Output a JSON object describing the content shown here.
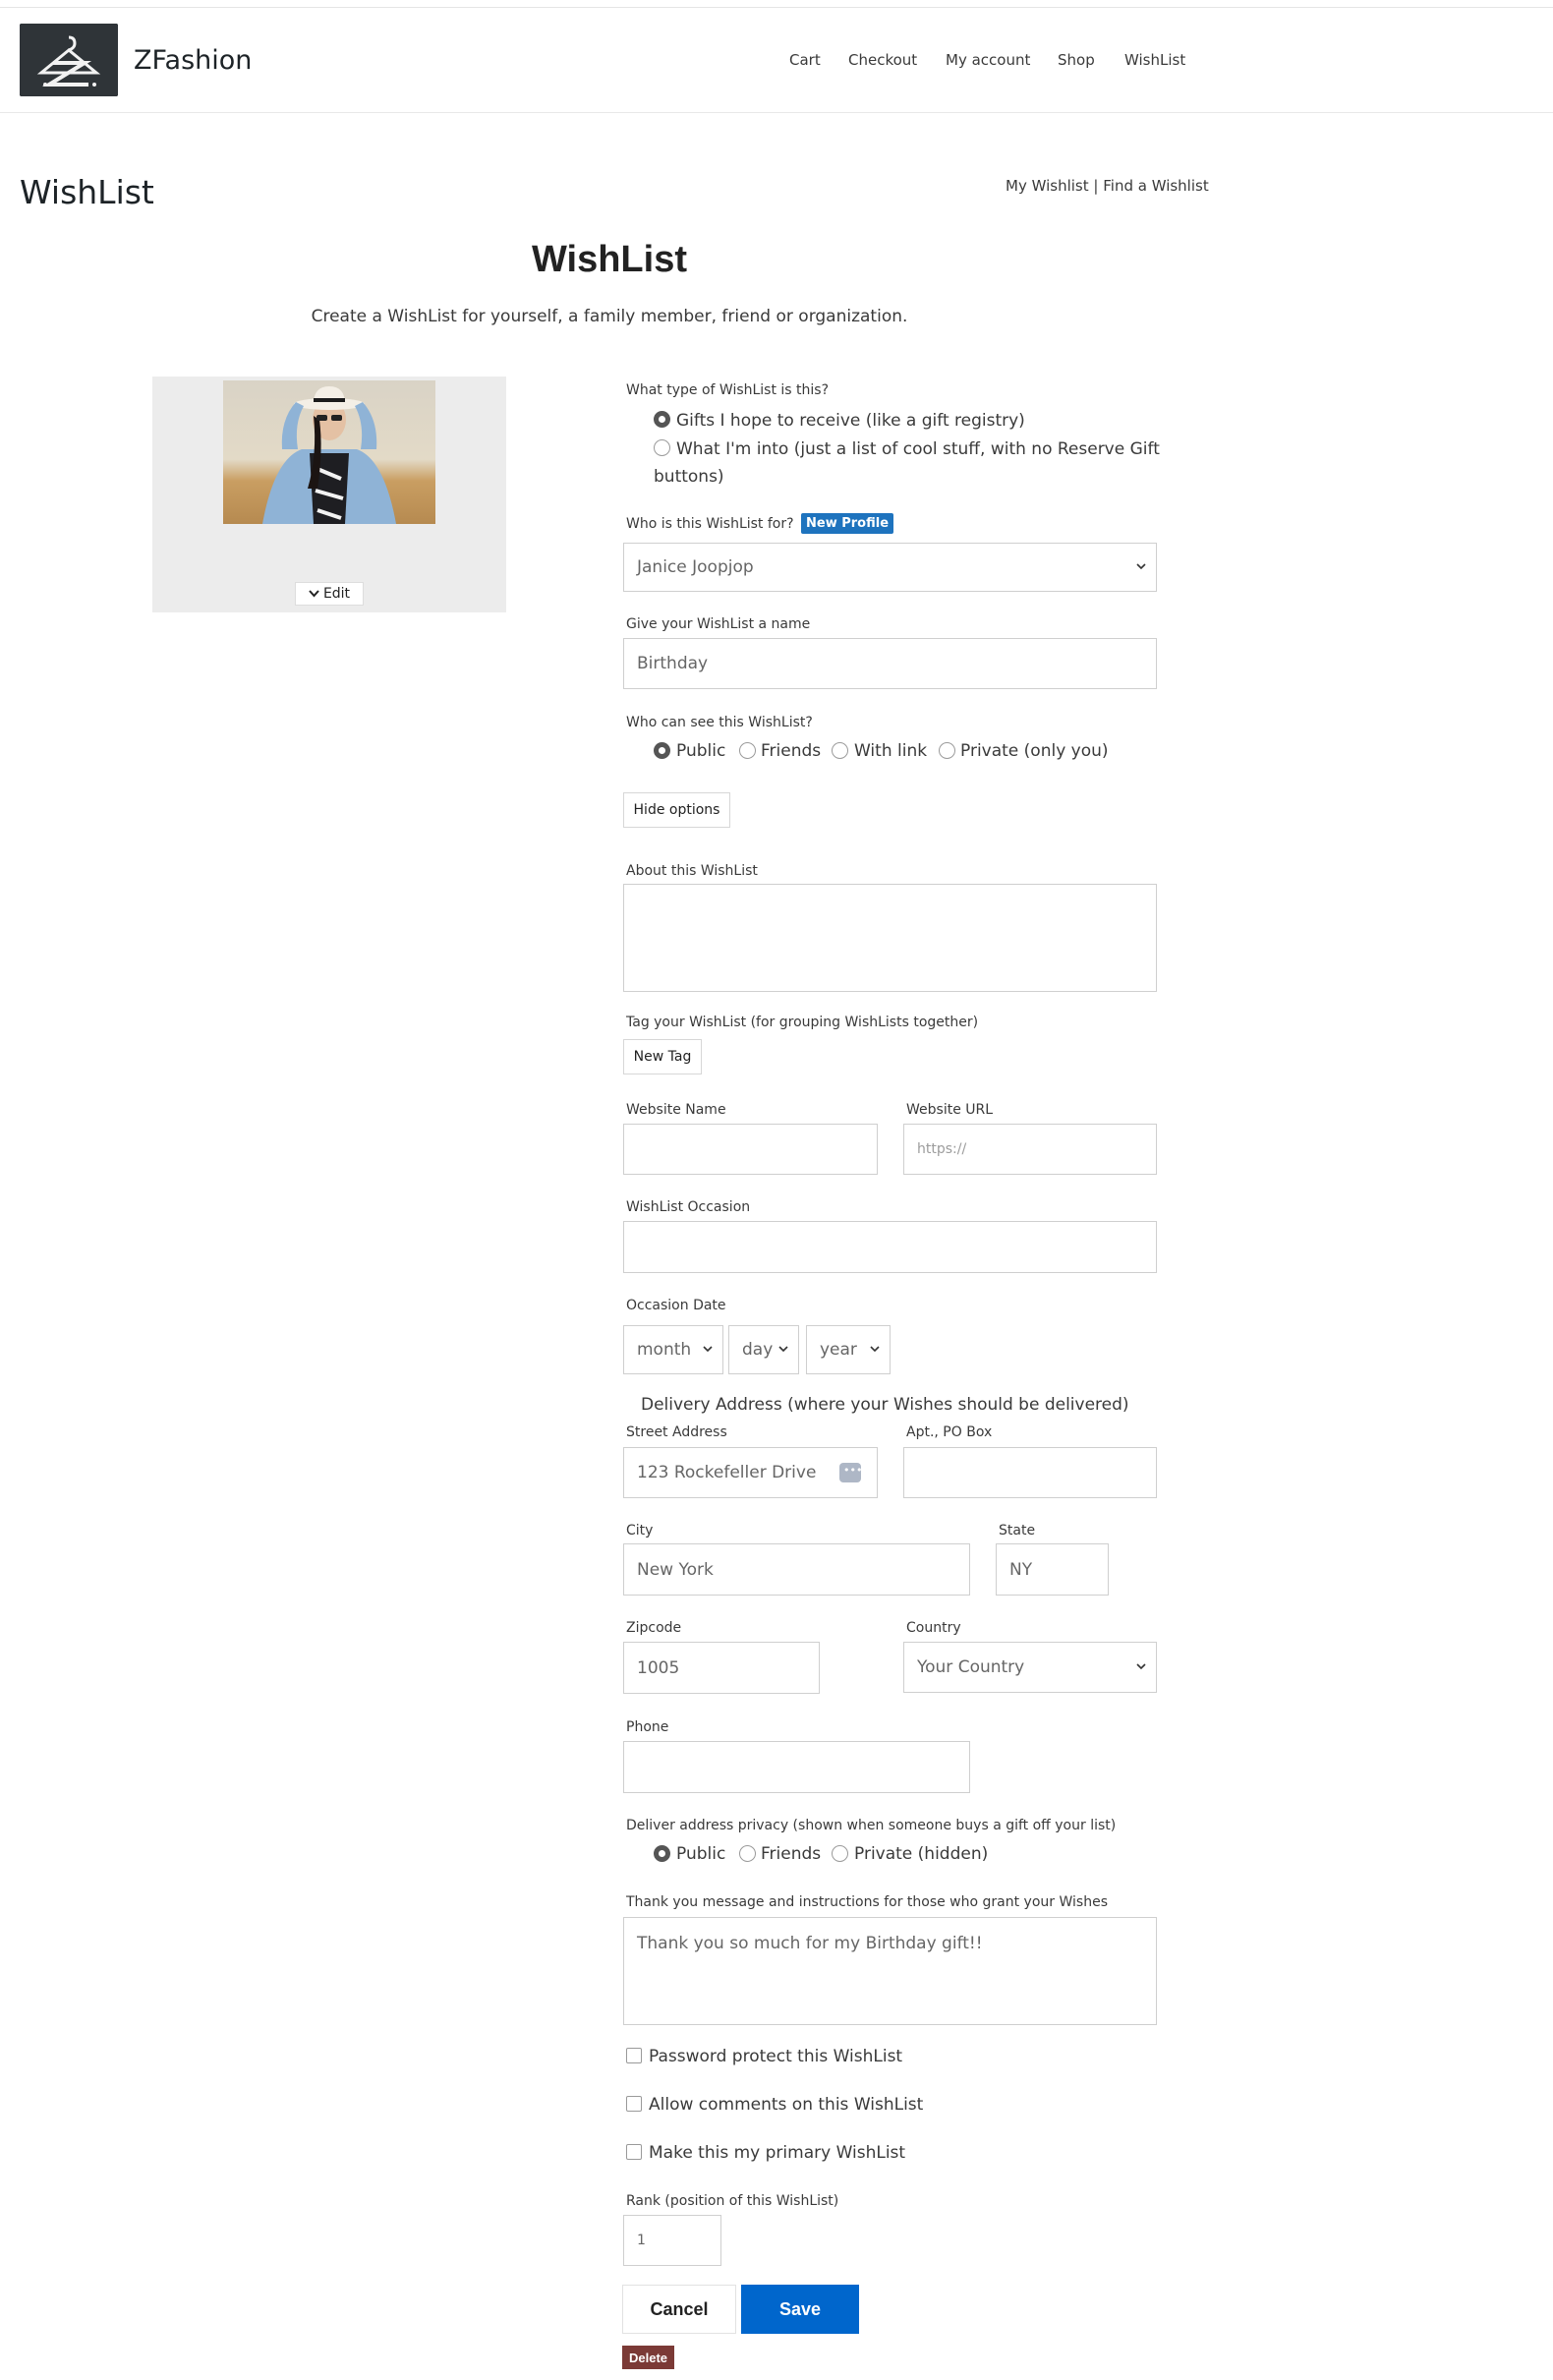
{
  "header": {
    "site_title": "ZFashion",
    "nav": [
      "Cart",
      "Checkout",
      "My account",
      "Shop",
      "WishList"
    ]
  },
  "page": {
    "title": "WishList",
    "links": {
      "my": "My Wishlist",
      "sep": "|",
      "find": "Find a Wishlist"
    }
  },
  "form": {
    "heading": "WishList",
    "subheading": "Create a WishList for yourself, a family member, friend or organization.",
    "image_edit_label": "Edit",
    "type_label": "What type of WishList is this?",
    "type_options": [
      {
        "label": "Gifts I hope to receive (like a gift registry)",
        "selected": true
      },
      {
        "label": "What I'm into (just a list of cool stuff, with no Reserve Gift",
        "label_cont": "buttons)",
        "selected": false
      }
    ],
    "for_label": "Who is this WishList for?",
    "new_profile": "New Profile",
    "for_value": "Janice Joopjop",
    "name_label": "Give your WishList a name",
    "name_value": "Birthday",
    "visibility_label": "Who can see this WishList?",
    "visibility_options": [
      "Public",
      "Friends",
      "With link",
      "Private (only you)"
    ],
    "visibility_selected": "Public",
    "hide_options": "Hide options",
    "about_label": "About this WishList",
    "tag_label": "Tag your WishList (for grouping WishLists together)",
    "new_tag": "New Tag",
    "website_name_label": "Website Name",
    "website_url_label": "Website URL",
    "website_url_placeholder": "https://",
    "occasion_label": "WishList Occasion",
    "occasion_date_label": "Occasion Date",
    "date_month": "month",
    "date_day": "day",
    "date_year": "year",
    "delivery_heading": "Delivery Address (where your Wishes should be delivered)",
    "street_label": "Street Address",
    "street_value": "123 Rockefeller Drive",
    "apt_label": "Apt., PO Box",
    "city_label": "City",
    "city_value": "New York",
    "state_label": "State",
    "state_value": "NY",
    "zip_label": "Zipcode",
    "zip_value": "1005",
    "country_label": "Country",
    "country_value": "Your Country",
    "phone_label": "Phone",
    "privacy_label": "Deliver address privacy (shown when someone buys a gift off your list)",
    "privacy_options": [
      "Public",
      "Friends",
      "Private (hidden)"
    ],
    "privacy_selected": "Public",
    "thanks_label": "Thank you message and instructions for those who grant your Wishes",
    "thanks_value": "Thank you so much for my Birthday gift!!",
    "checkboxes": [
      {
        "label": "Password protect this WishList",
        "checked": false
      },
      {
        "label": "Allow comments on this WishList",
        "checked": false
      },
      {
        "label": "Make this my primary WishList",
        "checked": false
      }
    ],
    "rank_label": "Rank (position of this WishList)",
    "rank_value": "1",
    "cancel": "Cancel",
    "save": "Save",
    "delete": "Delete"
  },
  "colors": {
    "primary": "#0066cc",
    "badge": "#1e73be",
    "delete": "#7b3a36"
  }
}
